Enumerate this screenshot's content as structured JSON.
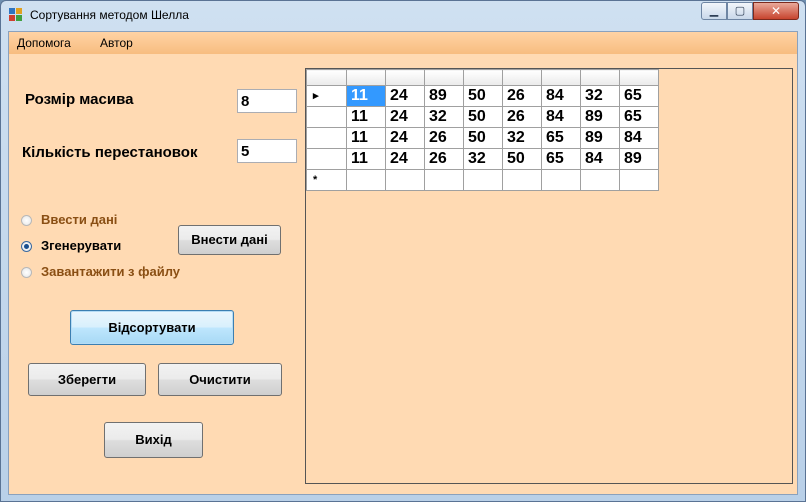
{
  "window": {
    "title": "Сортування методом Шелла"
  },
  "menu": [
    "Допомога",
    "Автор"
  ],
  "controls": {
    "size_label": "Розмір масива",
    "size_value": "8",
    "swaps_label": "Кількість перестановок",
    "swaps_value": "5"
  },
  "radio": [
    {
      "label": "Ввести дані",
      "checked": false,
      "enabled": false
    },
    {
      "label": "Згенерувати",
      "checked": true,
      "enabled": true
    },
    {
      "label": "Завантажити з файлу",
      "checked": false,
      "enabled": false
    }
  ],
  "buttons": {
    "enter": "Внести дані",
    "sort": "Відсортувати",
    "save": "Зберегти",
    "clear": "Очистити",
    "exit": "Вихід"
  },
  "grid": {
    "current_marker": "▸",
    "new_row_marker": "*",
    "rows": [
      [
        "11",
        "24",
        "89",
        "50",
        "26",
        "84",
        "32",
        "65"
      ],
      [
        "11",
        "24",
        "32",
        "50",
        "26",
        "84",
        "89",
        "65"
      ],
      [
        "11",
        "24",
        "26",
        "50",
        "32",
        "65",
        "89",
        "84"
      ],
      [
        "11",
        "24",
        "26",
        "32",
        "50",
        "65",
        "84",
        "89"
      ]
    ]
  },
  "colors": {
    "client_bg": "#ffdab3",
    "menubar": "#f7bd80",
    "disabled_radio_text": "#8a4f14",
    "selection": "#3399ff"
  }
}
